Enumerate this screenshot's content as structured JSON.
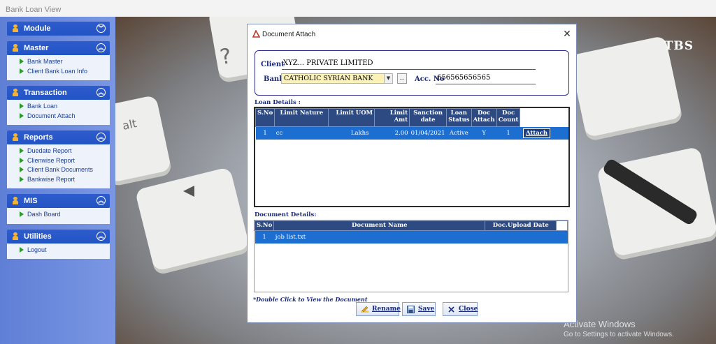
{
  "window": {
    "title": "Bank Loan View"
  },
  "sidebar": {
    "sections": [
      {
        "title": "Module",
        "chevron": "down",
        "items": []
      },
      {
        "title": "Master",
        "chevron": "up",
        "items": [
          "Bank Master",
          "Client Bank Loan Info"
        ]
      },
      {
        "title": "Transaction",
        "chevron": "up",
        "items": [
          "Bank Loan",
          "Document Attach"
        ]
      },
      {
        "title": "Reports",
        "chevron": "up",
        "items": [
          "Duedate Report",
          "Clienwise Report",
          "Client Bank Documents",
          "Bankwise Report"
        ]
      },
      {
        "title": "MIS",
        "chevron": "up",
        "items": [
          "Dash Board"
        ]
      },
      {
        "title": "Utilities",
        "chevron": "up",
        "items": [
          "Logout"
        ]
      }
    ]
  },
  "background": {
    "brand": "TBS",
    "keys": [
      "?",
      "alt"
    ]
  },
  "watermark": {
    "line1": "Activate Windows",
    "line2": "Go to Settings to activate Windows."
  },
  "dialog": {
    "title": "Document Attach",
    "close_glyph": "✕",
    "client": {
      "client_label": "Client",
      "client_value": "XYZ... PRIVATE LIMITED",
      "bank_label": "Bank",
      "bank_value": "CATHOLIC SYRIAN BANK",
      "browse_label": "...",
      "acc_label": "Acc. No",
      "acc_value": "656565656565"
    },
    "loan_details": {
      "label": "Loan Details :",
      "headers": [
        "S.No",
        "Limit Nature",
        "Limit UOM",
        "Limit Amt",
        "Sanction date",
        "Loan Status",
        "Doc Attach",
        "Doc Count"
      ],
      "rows": [
        {
          "sno": "1",
          "nature": "cc",
          "uom": "Lakhs",
          "amt": "2.00",
          "date": "01/04/2021",
          "status": "Active",
          "attach": "Y",
          "count": "1",
          "button": "Attach"
        }
      ]
    },
    "document_details": {
      "label": "Document Details:",
      "headers": [
        "S.No",
        "Document Name",
        "Doc.Upload Date"
      ],
      "rows": [
        {
          "sno": "1",
          "name": "job list.txt",
          "date": ""
        }
      ]
    },
    "note": "*Double Click to View the Document",
    "buttons": {
      "rename": "Rename",
      "save": "Save",
      "close": "Close"
    }
  },
  "colors": {
    "sidebar": "#6b8ae0",
    "section_header": "#2a58c8",
    "grid_header": "#2e4a82",
    "grid_selected": "#1c6fd1"
  }
}
